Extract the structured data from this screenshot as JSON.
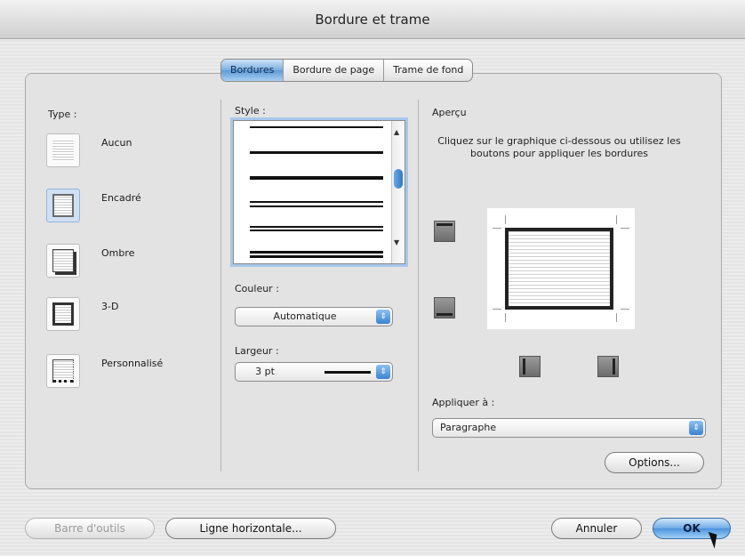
{
  "window": {
    "title": "Bordure et trame"
  },
  "tabs": [
    {
      "label": "Bordures",
      "active": true
    },
    {
      "label": "Bordure de page",
      "active": false
    },
    {
      "label": "Trame de fond",
      "active": false
    }
  ],
  "type": {
    "label": "Type :",
    "options": [
      {
        "label": "Aucun",
        "icon": "page-none-icon"
      },
      {
        "label": "Encadré",
        "icon": "page-box-icon",
        "selected": true
      },
      {
        "label": "Ombre",
        "icon": "page-shadow-icon"
      },
      {
        "label": "3-D",
        "icon": "page-3d-icon"
      },
      {
        "label": "Personnalisé",
        "icon": "page-custom-icon"
      }
    ]
  },
  "style": {
    "label": "Style :"
  },
  "couleur": {
    "label": "Couleur :",
    "value": "Automatique"
  },
  "largeur": {
    "label": "Largeur :",
    "value": "3 pt"
  },
  "apercu": {
    "label": "Aperçu",
    "instructions": "Cliquez sur le graphique ci-dessous ou utilisez les boutons pour appliquer les bordures"
  },
  "appliquer": {
    "label": "Appliquer à :",
    "value": "Paragraphe"
  },
  "buttons": {
    "options": "Options...",
    "barre_outils": "Barre d'outils",
    "ligne_horizontale": "Ligne horizontale...",
    "annuler": "Annuler",
    "ok": "OK"
  },
  "colors": {
    "accent": "#5d9ad8",
    "panel": "#e3e3e3"
  }
}
